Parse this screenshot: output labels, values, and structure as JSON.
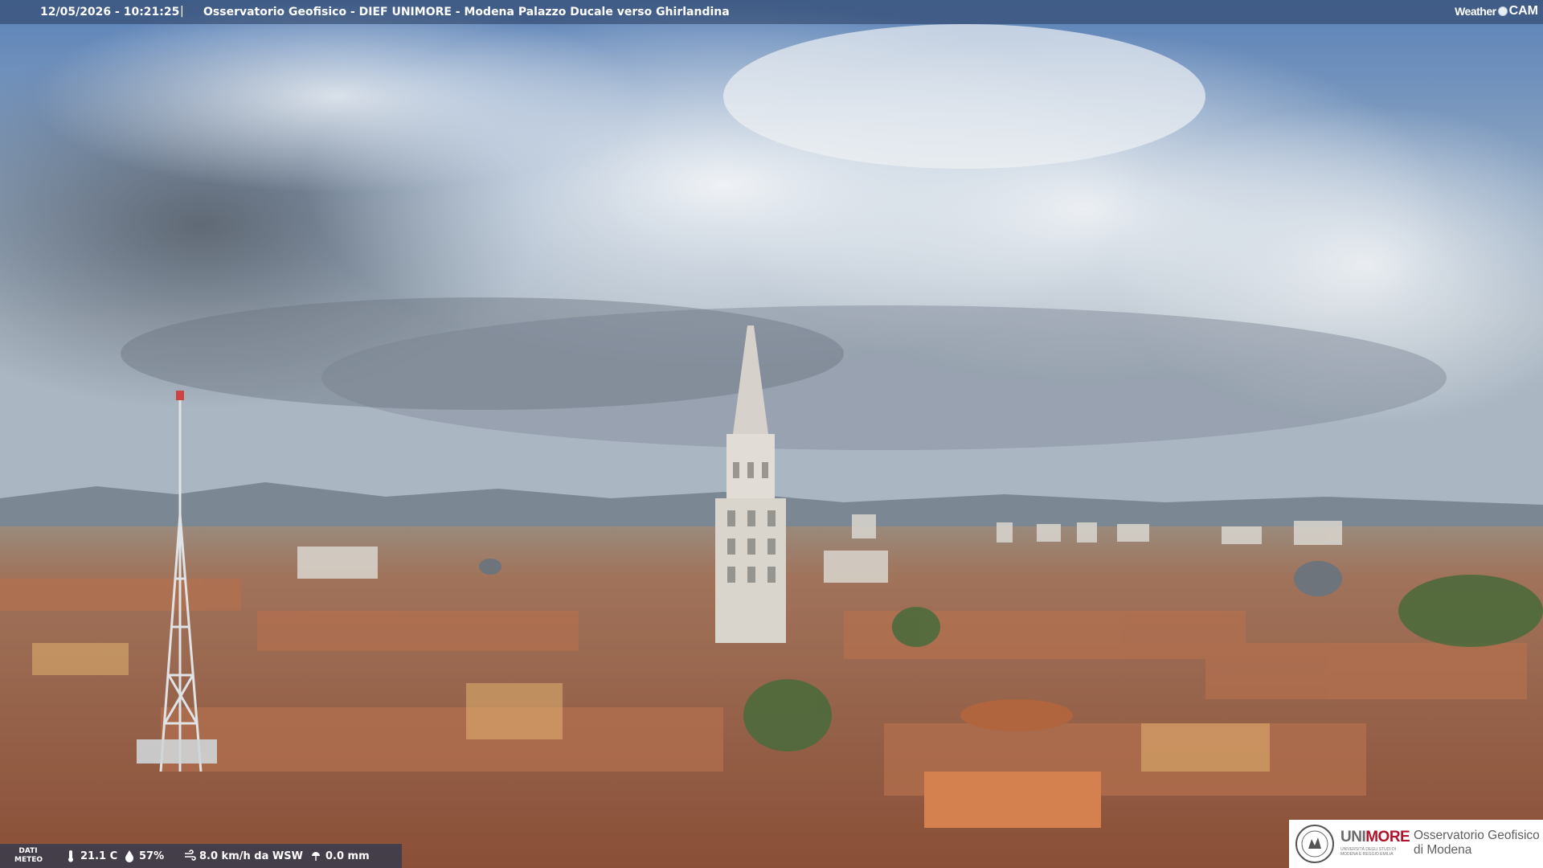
{
  "overlay": {
    "datetime": "12/05/2026 - 10:21:25",
    "separator": "|",
    "camera_title": "Osservatorio Geofisico - DIEF UNIMORE - Modena Palazzo Ducale verso Ghirlandina"
  },
  "brand_logo": {
    "word1": "Weather",
    "word2": "CAM"
  },
  "meteo": {
    "label": "DATI METEO",
    "temperature": "21.1 C",
    "humidity": "57%",
    "wind": "8.0 km/h da WSW",
    "rain": "0.0 mm",
    "icons": [
      "thermometer-icon",
      "humidity-icon",
      "wind-icon",
      "rain-icon"
    ]
  },
  "logo_box": {
    "uni": "UNI",
    "more": "MORE",
    "subtitle": "UNIVERSITÀ DEGLI STUDI DI MODENA E REGGIO EMILIA",
    "observatory_line1": "Osservatorio Geofisico",
    "observatory_line2": "di Modena"
  },
  "colors": {
    "sky_top": "#5b82b8",
    "cloud": "#e8ecef",
    "roof": "#a8694a",
    "tower": "#d9d4cc",
    "unimore_red": "#b2122a"
  }
}
